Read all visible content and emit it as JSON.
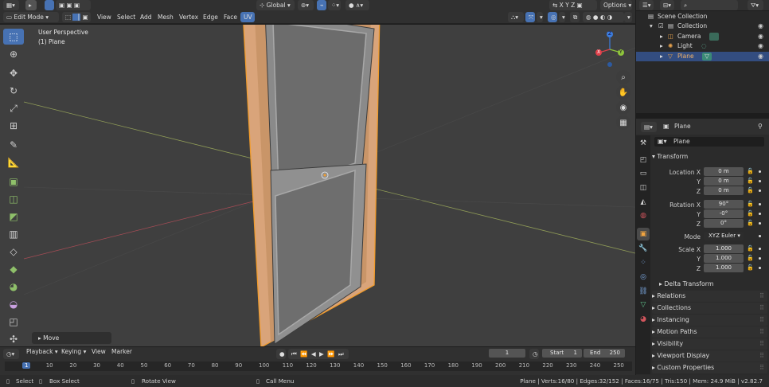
{
  "header": {
    "mode": "Edit Mode",
    "menus": [
      "View",
      "Select",
      "Add",
      "Mesh",
      "Vertex",
      "Edge",
      "Face",
      "UV"
    ],
    "orientation": "Global",
    "options": "Options"
  },
  "viewport": {
    "perspective": "User Perspective",
    "object": "(1) Plane",
    "last_operator": "Move",
    "gizmo": {
      "x": "X",
      "y": "Y",
      "z": "Z"
    }
  },
  "outliner": {
    "root": "Scene Collection",
    "items": [
      {
        "label": "Collection"
      },
      {
        "label": "Camera"
      },
      {
        "label": "Light"
      },
      {
        "label": "Plane"
      }
    ]
  },
  "properties": {
    "header_name": "Plane",
    "object_name": "Plane",
    "transform": {
      "title": "Transform",
      "location_label": "Location X",
      "location": [
        "0 m",
        "0 m",
        "0 m"
      ],
      "rotation_label": "Rotation X",
      "rotation": [
        "90°",
        "-0°",
        "0°"
      ],
      "mode_label": "Mode",
      "mode": "XYZ Euler",
      "scale_label": "Scale X",
      "scale": [
        "1.000",
        "1.000",
        "1.000"
      ],
      "axis_y": "Y",
      "axis_z": "Z",
      "delta": "Delta Transform"
    },
    "panels": [
      "Relations",
      "Collections",
      "Instancing",
      "Motion Paths",
      "Visibility",
      "Viewport Display",
      "Custom Properties"
    ]
  },
  "timeline": {
    "menus": [
      "Playback",
      "Keying",
      "View",
      "Marker"
    ],
    "current_frame": "1",
    "start_label": "Start",
    "start": "1",
    "end_label": "End",
    "end": "250",
    "ruler": [
      "1",
      "10",
      "20",
      "30",
      "40",
      "50",
      "60",
      "70",
      "80",
      "90",
      "100",
      "110",
      "120",
      "130",
      "140",
      "150",
      "160",
      "170",
      "180",
      "190",
      "200",
      "210",
      "220",
      "230",
      "240",
      "250"
    ]
  },
  "statusbar": {
    "select": "Select",
    "box_select": "Box Select",
    "rotate_view": "Rotate View",
    "call_menu": "Call Menu",
    "stats": "Plane | Verts:16/80 | Edges:32/152 | Faces:16/75 | Tris:150 | Mem: 24.9 MiB | v2.82.7"
  },
  "colors": {
    "accent": "#4772b3",
    "selected_row": "#334d80",
    "frame_wood": "#d4a276",
    "edit_orange": "#f29c2b",
    "glass": "#6e6e6e"
  }
}
